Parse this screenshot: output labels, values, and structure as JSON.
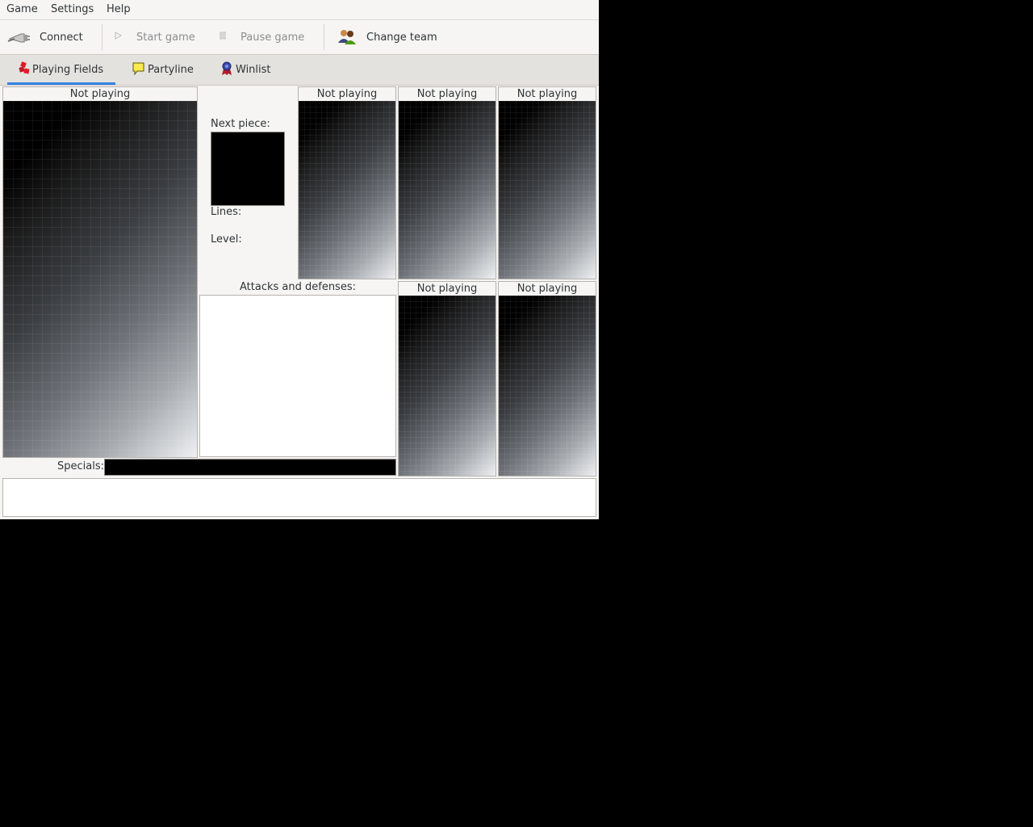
{
  "menubar": {
    "items": [
      {
        "label": "Game"
      },
      {
        "label": "Settings"
      },
      {
        "label": "Help"
      }
    ]
  },
  "toolbar": {
    "connect": {
      "label": "Connect",
      "icon": "plug-icon"
    },
    "start_game": {
      "label": "Start game",
      "icon": "play-icon",
      "enabled": false
    },
    "pause_game": {
      "label": "Pause game",
      "icon": "pause-icon",
      "enabled": false
    },
    "change_team": {
      "label": "Change team",
      "icon": "team-icon"
    }
  },
  "tabs": [
    {
      "label": "Playing Fields",
      "icon": "tetris-blocks-icon",
      "active": true
    },
    {
      "label": "Partyline",
      "icon": "speech-bubble-icon",
      "active": false
    },
    {
      "label": "Winlist",
      "icon": "ribbon-award-icon",
      "active": false
    }
  ],
  "player_field": {
    "status": "Not playing"
  },
  "info": {
    "next_piece_label": "Next piece:",
    "lines_label": "Lines:",
    "level_label": "Level:"
  },
  "attacks": {
    "label": "Attacks and defenses:"
  },
  "specials": {
    "label": "Specials:"
  },
  "opponents": [
    {
      "status": "Not playing"
    },
    {
      "status": "Not playing"
    },
    {
      "status": "Not playing"
    },
    {
      "status": "Not playing"
    },
    {
      "status": "Not playing"
    }
  ],
  "colors": {
    "accent": "#3584e4",
    "window_bg": "#f6f5f4",
    "field_bg": "#000000"
  }
}
